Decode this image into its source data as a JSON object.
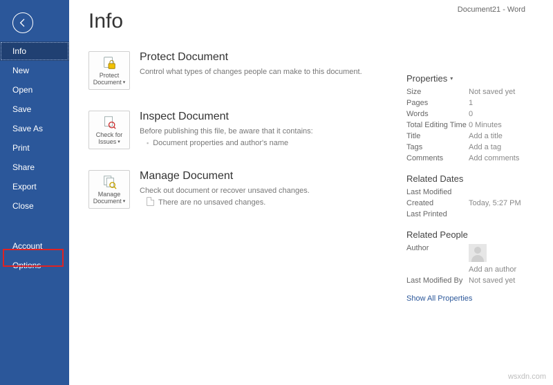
{
  "window": {
    "title": "Document21  -  Word"
  },
  "sidebar": {
    "items": [
      {
        "label": "Info",
        "selected": true
      },
      {
        "label": "New",
        "selected": false
      },
      {
        "label": "Open",
        "selected": false
      },
      {
        "label": "Save",
        "selected": false
      },
      {
        "label": "Save As",
        "selected": false
      },
      {
        "label": "Print",
        "selected": false
      },
      {
        "label": "Share",
        "selected": false
      },
      {
        "label": "Export",
        "selected": false
      },
      {
        "label": "Close",
        "selected": false
      },
      {
        "label": "Account",
        "selected": false
      },
      {
        "label": "Options",
        "selected": false
      }
    ]
  },
  "page": {
    "title": "Info",
    "sections": {
      "protect": {
        "tile": "Protect Document",
        "heading": "Protect Document",
        "desc": "Control what types of changes people can make to this document."
      },
      "inspect": {
        "tile": "Check for Issues",
        "heading": "Inspect Document",
        "desc": "Before publishing this file, be aware that it contains:",
        "bullet1": "Document properties and author's name"
      },
      "manage": {
        "tile": "Manage Document",
        "heading": "Manage Document",
        "desc": "Check out document or recover unsaved changes.",
        "note": "There are no unsaved changes."
      }
    }
  },
  "properties": {
    "heading": "Properties",
    "rows": {
      "size": {
        "k": "Size",
        "v": "Not saved yet"
      },
      "pages": {
        "k": "Pages",
        "v": "1"
      },
      "words": {
        "k": "Words",
        "v": "0"
      },
      "tet": {
        "k": "Total Editing Time",
        "v": "0 Minutes"
      },
      "title": {
        "k": "Title",
        "v": "Add a title"
      },
      "tags": {
        "k": "Tags",
        "v": "Add a tag"
      },
      "comm": {
        "k": "Comments",
        "v": "Add comments"
      }
    },
    "dates": {
      "heading": "Related Dates",
      "lastmod": {
        "k": "Last Modified",
        "v": ""
      },
      "created": {
        "k": "Created",
        "v": "Today, 5:27 PM"
      },
      "lastprint": {
        "k": "Last Printed",
        "v": ""
      }
    },
    "people": {
      "heading": "Related People",
      "author": {
        "k": "Author",
        "v": "Add an author"
      },
      "lastmodby": {
        "k": "Last Modified By",
        "v": "Not saved yet"
      }
    },
    "showall": "Show All Properties"
  },
  "watermark": "wsxdn.com"
}
